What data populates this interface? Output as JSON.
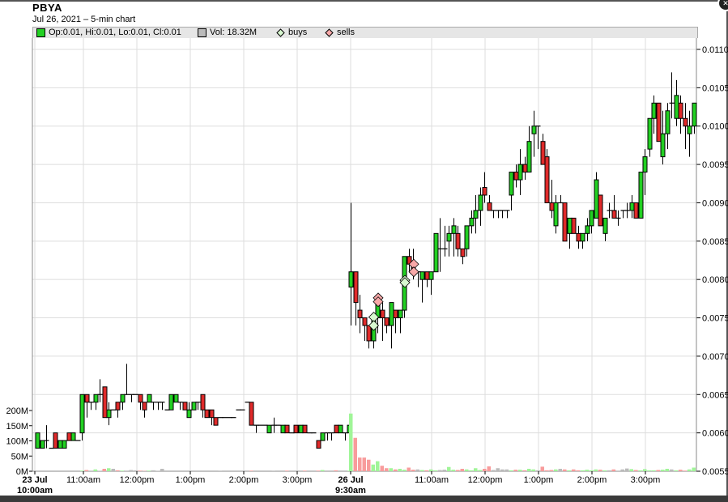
{
  "header": {
    "symbol": "PBYA",
    "subtitle": "Jul 26, 2021  – 5-min chart"
  },
  "legend": {
    "ohlc": "Op:0.01, Hi:0.01, Lo:0.01, Cl:0.01",
    "volume": "Vol: 18.32M",
    "buys": "buys",
    "sells": "sells"
  },
  "colors": {
    "up": "#22d022",
    "down": "#e02a2a",
    "vol_up": "#a0f598",
    "vol_down": "#f89c9c",
    "vol_flat": "#bbbbbb",
    "buy_marker": "#d8f8d0",
    "sell_marker": "#f8a8a8",
    "grid": "#dddddd"
  },
  "chart_data": {
    "type": "candlestick",
    "price_unit": 0.0001,
    "price_axis": {
      "ylim": [
        0.0055,
        0.011
      ],
      "ticks": [
        "0.0110",
        "0.0105",
        "0.0100",
        "0.0095",
        "0.0090",
        "0.0085",
        "0.0080",
        "0.0075",
        "0.0070",
        "0.0065",
        "0.0060",
        "0.0055"
      ]
    },
    "volume_axis": {
      "ticks": [
        "200M",
        "150M",
        "100M",
        "50M",
        "0M"
      ],
      "unit": "M"
    },
    "x_ticks": [
      {
        "label": "23 Jul",
        "label2": "10:00am",
        "bold": true
      },
      {
        "label": "11:00am"
      },
      {
        "label": "12:00pm"
      },
      {
        "label": "1:00pm"
      },
      {
        "label": "2:00pm"
      },
      {
        "label": "3:00pm"
      },
      {
        "label": "26 Jul",
        "label2": "9:30am",
        "bold": true
      },
      {
        "label": "11:00am"
      },
      {
        "label": "12:00pm"
      },
      {
        "label": "1:00pm"
      },
      {
        "label": "2:00pm"
      },
      {
        "label": "3:00pm"
      }
    ],
    "day1_ohlc": [
      [
        58,
        60,
        58,
        60
      ],
      [
        58,
        59,
        58,
        59
      ],
      [
        59,
        61,
        58,
        59
      ],
      [
        58,
        58,
        58,
        58
      ],
      [
        60,
        60,
        58,
        58
      ],
      [
        58,
        59,
        58,
        59
      ],
      [
        58,
        59,
        58,
        59
      ],
      [
        60,
        60,
        59,
        59
      ],
      [
        59,
        60,
        59,
        60
      ],
      [
        59,
        59,
        59,
        59
      ],
      [
        60,
        65,
        59,
        65
      ],
      [
        65,
        65,
        62,
        64
      ],
      [
        64,
        64,
        63,
        64
      ],
      [
        64,
        65,
        63,
        65
      ],
      [
        65,
        67,
        64,
        65
      ],
      [
        66,
        66,
        62,
        62
      ],
      [
        62,
        64,
        61,
        63
      ],
      [
        63,
        63,
        63,
        63
      ],
      [
        64,
        64,
        62,
        63
      ],
      [
        64,
        65,
        63,
        65
      ],
      [
        65,
        69,
        65,
        65
      ],
      [
        65,
        65,
        64,
        65
      ],
      [
        65,
        65,
        65,
        65
      ],
      [
        65,
        65,
        63,
        64
      ],
      [
        64,
        64,
        62,
        63
      ],
      [
        64,
        65,
        64,
        65
      ],
      [
        64,
        64,
        63,
        64
      ],
      [
        64,
        64,
        63,
        64
      ],
      [
        64,
        64,
        63,
        64
      ],
      [
        63,
        63,
        63,
        63
      ],
      [
        63,
        65,
        63,
        65
      ],
      [
        64,
        65,
        64,
        65
      ],
      [
        64,
        64,
        63,
        64
      ],
      [
        64,
        64,
        63,
        63
      ],
      [
        62,
        64,
        62,
        63
      ],
      [
        63,
        64,
        63,
        64
      ],
      [
        64,
        64,
        63,
        64
      ],
      [
        65,
        65,
        62,
        63
      ],
      [
        63,
        63,
        62,
        62
      ],
      [
        63,
        63,
        61,
        62
      ],
      [
        62,
        62,
        61,
        61
      ],
      [
        62,
        62,
        62,
        62
      ],
      [
        62,
        62,
        62,
        62
      ],
      [
        62,
        62,
        62,
        62
      ],
      [
        62,
        62,
        62,
        62
      ],
      [
        63,
        63,
        63,
        63
      ],
      [
        63,
        63,
        63,
        63
      ],
      [
        64,
        64,
        64,
        64
      ],
      [
        64,
        64,
        61,
        61
      ],
      [
        61,
        61,
        60,
        61
      ],
      [
        61,
        61,
        61,
        61
      ],
      [
        61,
        61,
        61,
        61
      ],
      [
        60,
        61,
        60,
        61
      ],
      [
        61,
        62,
        60,
        61
      ],
      [
        61,
        61,
        61,
        61
      ],
      [
        60,
        61,
        60,
        61
      ],
      [
        61,
        61,
        60,
        60
      ],
      [
        60,
        60,
        60,
        60
      ],
      [
        61,
        61,
        60,
        60
      ],
      [
        60,
        61,
        60,
        61
      ],
      [
        61,
        61,
        60,
        60
      ],
      [
        60,
        60,
        60,
        60
      ],
      [
        60,
        60,
        60,
        60
      ],
      [
        59,
        59,
        58,
        58
      ],
      [
        59,
        60,
        59,
        60
      ],
      [
        60,
        60,
        59,
        60
      ],
      [
        60,
        60,
        59,
        60
      ],
      [
        61,
        61,
        60,
        60
      ],
      [
        60,
        61,
        60,
        61
      ],
      [
        60,
        60,
        59,
        60
      ],
      [
        60,
        61,
        60,
        61
      ]
    ],
    "day1_volume_m": [
      0,
      0,
      0,
      0,
      0,
      0,
      0,
      0,
      0,
      0,
      2,
      4,
      2,
      6,
      1,
      8,
      10,
      8,
      3,
      2,
      2,
      4,
      3,
      2,
      1,
      2,
      3,
      1,
      8,
      0,
      0,
      0,
      0,
      0,
      0,
      0,
      0,
      0,
      0,
      0,
      0,
      2,
      0,
      0,
      0,
      0,
      0,
      0,
      2,
      0,
      0,
      0,
      0,
      2,
      0,
      0,
      2,
      0,
      0,
      0,
      2,
      0,
      0,
      2,
      4,
      0,
      0,
      3,
      0,
      0,
      2
    ],
    "day2_ohlc": [
      [
        79,
        90,
        74,
        81
      ],
      [
        81,
        81,
        74,
        77
      ],
      [
        76,
        78,
        73,
        75
      ],
      [
        75,
        75,
        72,
        74
      ],
      [
        74,
        74,
        71,
        72
      ],
      [
        72,
        75,
        71,
        75
      ],
      [
        75,
        78,
        73,
        77
      ],
      [
        76,
        77,
        72,
        75
      ],
      [
        75,
        75,
        73,
        74
      ],
      [
        74,
        77,
        71,
        77
      ],
      [
        76,
        76,
        73,
        75
      ],
      [
        75,
        76,
        73,
        76
      ],
      [
        76,
        83,
        75,
        83
      ],
      [
        83,
        84,
        81,
        82
      ],
      [
        82,
        84,
        80,
        81
      ],
      [
        81,
        81,
        79,
        81
      ],
      [
        80,
        81,
        77,
        81
      ],
      [
        81,
        81,
        79,
        80
      ],
      [
        80,
        81,
        78,
        81
      ],
      [
        81,
        86,
        81,
        86
      ],
      [
        84,
        88,
        81,
        84
      ],
      [
        84,
        87,
        83,
        84
      ],
      [
        85,
        87,
        83,
        86
      ],
      [
        86,
        88,
        83,
        87
      ],
      [
        86,
        87,
        83,
        84
      ],
      [
        84,
        84,
        82,
        83
      ],
      [
        84,
        87,
        83,
        87
      ],
      [
        87,
        89,
        86,
        88
      ],
      [
        88,
        91,
        86,
        89
      ],
      [
        89,
        92,
        87,
        91
      ],
      [
        92,
        94,
        90,
        91
      ],
      [
        90,
        91,
        89,
        89
      ],
      [
        89,
        89,
        88,
        89
      ],
      [
        89,
        89,
        88,
        89
      ],
      [
        89,
        89,
        88,
        89
      ],
      [
        89,
        89,
        88,
        89
      ],
      [
        91,
        94,
        89,
        94
      ],
      [
        94,
        95,
        92,
        93
      ],
      [
        93,
        97,
        91,
        95
      ],
      [
        95,
        96,
        93,
        94
      ],
      [
        94,
        100,
        94,
        98
      ],
      [
        99,
        102,
        96,
        100
      ],
      [
        100,
        100,
        97,
        100
      ],
      [
        98,
        99,
        95,
        95
      ],
      [
        96,
        97,
        90,
        90
      ],
      [
        90,
        93,
        88,
        89
      ],
      [
        87,
        91,
        86,
        90
      ],
      [
        90,
        91,
        90,
        90
      ],
      [
        90,
        90,
        85,
        85
      ],
      [
        86,
        88,
        84,
        88
      ],
      [
        88,
        88,
        86,
        86
      ],
      [
        86,
        87,
        84,
        85
      ],
      [
        85,
        86,
        84,
        86
      ],
      [
        86,
        88,
        85,
        87
      ],
      [
        87,
        89,
        86,
        89
      ],
      [
        88,
        94,
        88,
        93
      ],
      [
        91,
        91,
        87,
        87
      ],
      [
        86,
        88,
        85,
        88
      ],
      [
        89,
        90,
        88,
        89
      ],
      [
        89,
        91,
        88,
        88
      ],
      [
        88,
        89,
        87,
        88
      ],
      [
        89,
        89,
        88,
        89
      ],
      [
        89,
        90,
        88,
        89
      ],
      [
        89,
        91,
        88,
        90
      ],
      [
        90,
        90,
        88,
        88
      ],
      [
        88,
        94,
        88,
        94
      ],
      [
        94,
        97,
        91,
        96
      ],
      [
        97,
        101,
        96,
        101
      ],
      [
        101,
        104,
        99,
        103
      ],
      [
        103,
        103,
        98,
        98
      ],
      [
        96,
        102,
        95,
        99
      ],
      [
        99,
        103,
        97,
        102
      ],
      [
        103,
        107,
        101,
        103
      ],
      [
        101,
        106,
        100,
        104
      ],
      [
        103,
        104,
        99,
        101
      ],
      [
        101,
        103,
        97,
        100
      ],
      [
        99,
        102,
        96,
        100
      ],
      [
        100,
        103,
        99,
        103
      ]
    ],
    "day2_volume_m": [
      190,
      110,
      45,
      45,
      38,
      22,
      33,
      18,
      10,
      10,
      6,
      8,
      5,
      12,
      5,
      6,
      4,
      3,
      6,
      3,
      4,
      5,
      14,
      5,
      4,
      8,
      6,
      3,
      10,
      4,
      8,
      16,
      4,
      10,
      6,
      6,
      3,
      5,
      5,
      3,
      8,
      6,
      3,
      15,
      3,
      4,
      6,
      8,
      6,
      3,
      6,
      3,
      3,
      5,
      3,
      6,
      5,
      3,
      3,
      6,
      2,
      6,
      9,
      7,
      4,
      3,
      7,
      3,
      3,
      4,
      5,
      8,
      6,
      3,
      5,
      2,
      6,
      12
    ],
    "markers": [
      {
        "type": "buy",
        "bar": 5,
        "price": 0.00751
      },
      {
        "type": "buy",
        "bar": 5,
        "price": 0.0074
      },
      {
        "type": "sell",
        "bar": 6,
        "price": 0.00776
      },
      {
        "type": "sell",
        "bar": 6,
        "price": 0.00771
      },
      {
        "type": "buy",
        "bar": 12,
        "price": 0.00799
      },
      {
        "type": "buy",
        "bar": 12,
        "price": 0.00796
      },
      {
        "type": "sell",
        "bar": 14,
        "price": 0.0082
      },
      {
        "type": "sell",
        "bar": 14,
        "price": 0.0081
      }
    ]
  }
}
